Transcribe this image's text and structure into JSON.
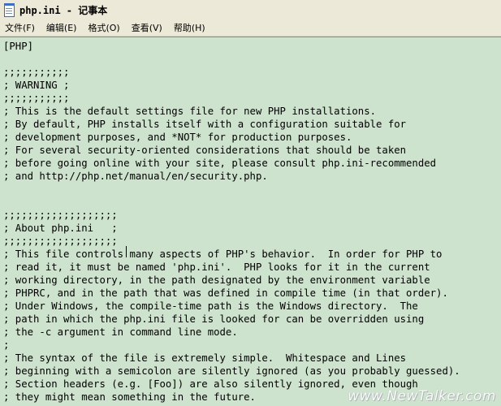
{
  "window": {
    "title": "php.ini - 记事本"
  },
  "menu": {
    "items": [
      {
        "label": "文件(F)"
      },
      {
        "label": "编辑(E)"
      },
      {
        "label": "格式(O)"
      },
      {
        "label": "查看(V)"
      },
      {
        "label": "帮助(H)"
      }
    ]
  },
  "editor": {
    "background_color": "#cde3cd",
    "text": "[PHP]\n\n;;;;;;;;;;;\n; WARNING ;\n;;;;;;;;;;;\n; This is the default settings file for new PHP installations.\n; By default, PHP installs itself with a configuration suitable for\n; development purposes, and *NOT* for production purposes.\n; For several security-oriented considerations that should be taken\n; before going online with your site, please consult php.ini-recommended\n; and http://php.net/manual/en/security.php.\n\n\n;;;;;;;;;;;;;;;;;;;\n; About php.ini   ;\n;;;;;;;;;;;;;;;;;;;\n; This file controls many aspects of PHP's behavior.  In order for PHP to\n; read it, it must be named 'php.ini'.  PHP looks for it in the current\n; working directory, in the path designated by the environment variable\n; PHPRC, and in the path that was defined in compile time (in that order).\n; Under Windows, the compile-time path is the Windows directory.  The\n; path in which the php.ini file is looked for can be overridden using\n; the -c argument in command line mode.\n;\n; The syntax of the file is extremely simple.  Whitespace and Lines\n; beginning with a semicolon are silently ignored (as you probably guessed).\n; Section headers (e.g. [Foo]) are also silently ignored, even though\n; they might mean something in the future."
  },
  "watermark": {
    "text": "www.NewTalker.com"
  }
}
